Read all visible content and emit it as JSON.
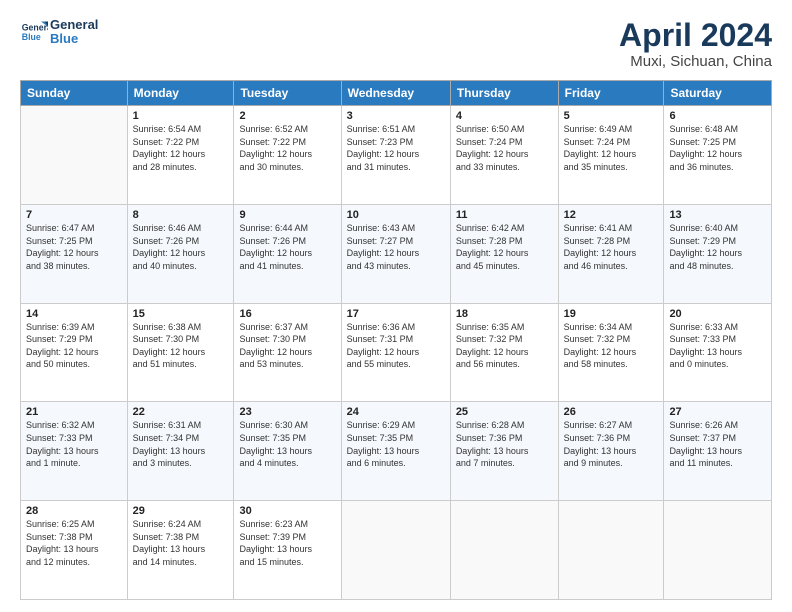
{
  "logo": {
    "line1": "General",
    "line2": "Blue"
  },
  "title": "April 2024",
  "subtitle": "Muxi, Sichuan, China",
  "weekdays": [
    "Sunday",
    "Monday",
    "Tuesday",
    "Wednesday",
    "Thursday",
    "Friday",
    "Saturday"
  ],
  "weeks": [
    [
      {
        "day": "",
        "info": ""
      },
      {
        "day": "1",
        "info": "Sunrise: 6:54 AM\nSunset: 7:22 PM\nDaylight: 12 hours\nand 28 minutes."
      },
      {
        "day": "2",
        "info": "Sunrise: 6:52 AM\nSunset: 7:22 PM\nDaylight: 12 hours\nand 30 minutes."
      },
      {
        "day": "3",
        "info": "Sunrise: 6:51 AM\nSunset: 7:23 PM\nDaylight: 12 hours\nand 31 minutes."
      },
      {
        "day": "4",
        "info": "Sunrise: 6:50 AM\nSunset: 7:24 PM\nDaylight: 12 hours\nand 33 minutes."
      },
      {
        "day": "5",
        "info": "Sunrise: 6:49 AM\nSunset: 7:24 PM\nDaylight: 12 hours\nand 35 minutes."
      },
      {
        "day": "6",
        "info": "Sunrise: 6:48 AM\nSunset: 7:25 PM\nDaylight: 12 hours\nand 36 minutes."
      }
    ],
    [
      {
        "day": "7",
        "info": "Sunrise: 6:47 AM\nSunset: 7:25 PM\nDaylight: 12 hours\nand 38 minutes."
      },
      {
        "day": "8",
        "info": "Sunrise: 6:46 AM\nSunset: 7:26 PM\nDaylight: 12 hours\nand 40 minutes."
      },
      {
        "day": "9",
        "info": "Sunrise: 6:44 AM\nSunset: 7:26 PM\nDaylight: 12 hours\nand 41 minutes."
      },
      {
        "day": "10",
        "info": "Sunrise: 6:43 AM\nSunset: 7:27 PM\nDaylight: 12 hours\nand 43 minutes."
      },
      {
        "day": "11",
        "info": "Sunrise: 6:42 AM\nSunset: 7:28 PM\nDaylight: 12 hours\nand 45 minutes."
      },
      {
        "day": "12",
        "info": "Sunrise: 6:41 AM\nSunset: 7:28 PM\nDaylight: 12 hours\nand 46 minutes."
      },
      {
        "day": "13",
        "info": "Sunrise: 6:40 AM\nSunset: 7:29 PM\nDaylight: 12 hours\nand 48 minutes."
      }
    ],
    [
      {
        "day": "14",
        "info": "Sunrise: 6:39 AM\nSunset: 7:29 PM\nDaylight: 12 hours\nand 50 minutes."
      },
      {
        "day": "15",
        "info": "Sunrise: 6:38 AM\nSunset: 7:30 PM\nDaylight: 12 hours\nand 51 minutes."
      },
      {
        "day": "16",
        "info": "Sunrise: 6:37 AM\nSunset: 7:30 PM\nDaylight: 12 hours\nand 53 minutes."
      },
      {
        "day": "17",
        "info": "Sunrise: 6:36 AM\nSunset: 7:31 PM\nDaylight: 12 hours\nand 55 minutes."
      },
      {
        "day": "18",
        "info": "Sunrise: 6:35 AM\nSunset: 7:32 PM\nDaylight: 12 hours\nand 56 minutes."
      },
      {
        "day": "19",
        "info": "Sunrise: 6:34 AM\nSunset: 7:32 PM\nDaylight: 12 hours\nand 58 minutes."
      },
      {
        "day": "20",
        "info": "Sunrise: 6:33 AM\nSunset: 7:33 PM\nDaylight: 13 hours\nand 0 minutes."
      }
    ],
    [
      {
        "day": "21",
        "info": "Sunrise: 6:32 AM\nSunset: 7:33 PM\nDaylight: 13 hours\nand 1 minute."
      },
      {
        "day": "22",
        "info": "Sunrise: 6:31 AM\nSunset: 7:34 PM\nDaylight: 13 hours\nand 3 minutes."
      },
      {
        "day": "23",
        "info": "Sunrise: 6:30 AM\nSunset: 7:35 PM\nDaylight: 13 hours\nand 4 minutes."
      },
      {
        "day": "24",
        "info": "Sunrise: 6:29 AM\nSunset: 7:35 PM\nDaylight: 13 hours\nand 6 minutes."
      },
      {
        "day": "25",
        "info": "Sunrise: 6:28 AM\nSunset: 7:36 PM\nDaylight: 13 hours\nand 7 minutes."
      },
      {
        "day": "26",
        "info": "Sunrise: 6:27 AM\nSunset: 7:36 PM\nDaylight: 13 hours\nand 9 minutes."
      },
      {
        "day": "27",
        "info": "Sunrise: 6:26 AM\nSunset: 7:37 PM\nDaylight: 13 hours\nand 11 minutes."
      }
    ],
    [
      {
        "day": "28",
        "info": "Sunrise: 6:25 AM\nSunset: 7:38 PM\nDaylight: 13 hours\nand 12 minutes."
      },
      {
        "day": "29",
        "info": "Sunrise: 6:24 AM\nSunset: 7:38 PM\nDaylight: 13 hours\nand 14 minutes."
      },
      {
        "day": "30",
        "info": "Sunrise: 6:23 AM\nSunset: 7:39 PM\nDaylight: 13 hours\nand 15 minutes."
      },
      {
        "day": "",
        "info": ""
      },
      {
        "day": "",
        "info": ""
      },
      {
        "day": "",
        "info": ""
      },
      {
        "day": "",
        "info": ""
      }
    ]
  ]
}
